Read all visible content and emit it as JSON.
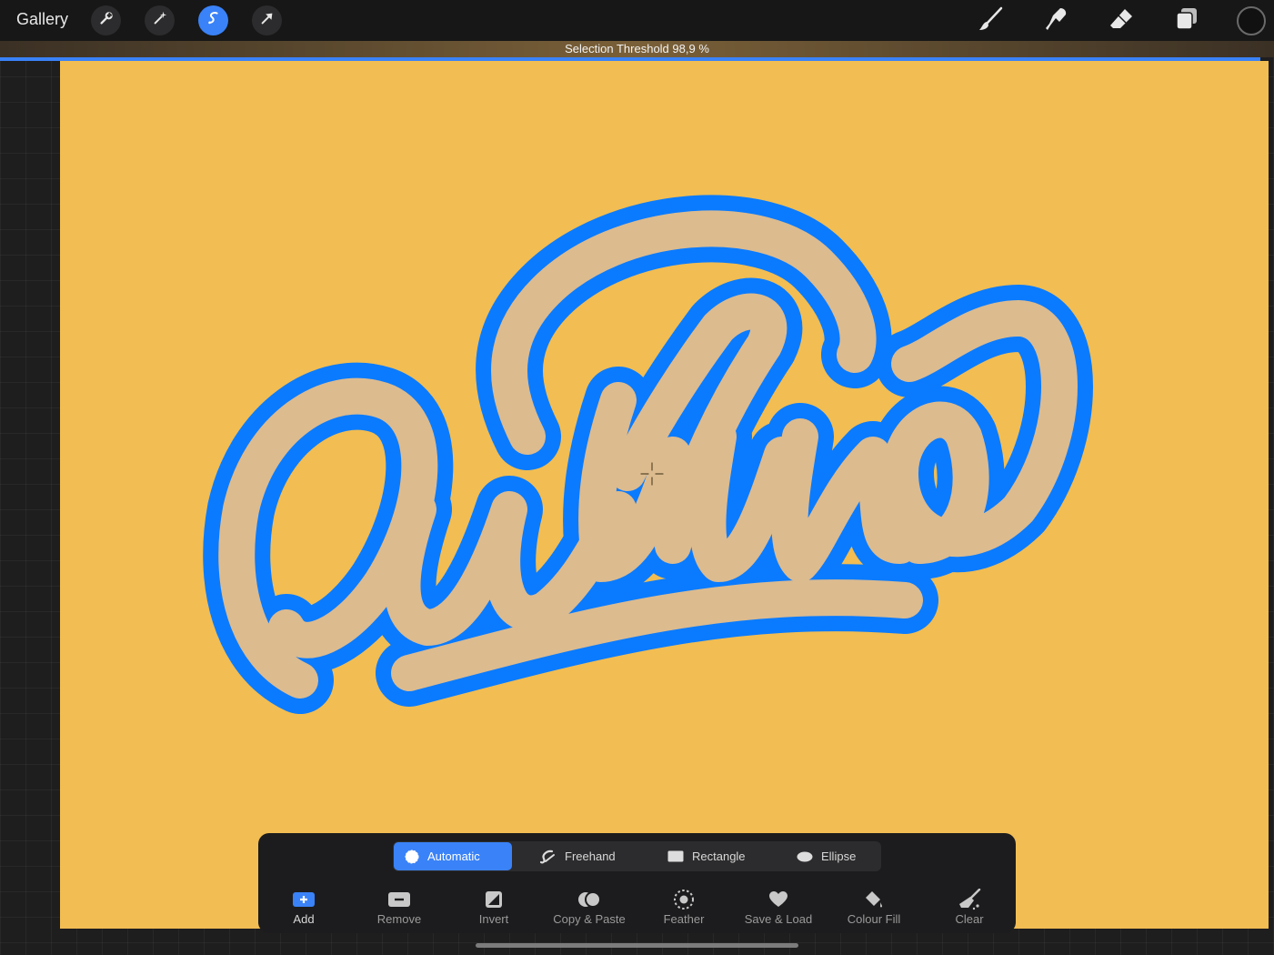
{
  "app": {
    "gallery_label": "Gallery"
  },
  "toolbar": {
    "left_tools": [
      {
        "name": "Actions",
        "icon": "wrench-icon"
      },
      {
        "name": "Adjustments",
        "icon": "magic-wand-icon"
      },
      {
        "name": "Selection",
        "icon": "selection-icon",
        "active": true
      },
      {
        "name": "Transform",
        "icon": "arrow-cursor-icon"
      }
    ],
    "right_tools": [
      {
        "name": "Paint",
        "icon": "brush-icon"
      },
      {
        "name": "Smudge",
        "icon": "smudge-icon"
      },
      {
        "name": "Erase",
        "icon": "eraser-icon"
      },
      {
        "name": "Layers",
        "icon": "layers-icon"
      }
    ],
    "color": "#111111"
  },
  "threshold": {
    "label": "Selection Threshold 98,9 %",
    "value": 0.989
  },
  "selection_panel": {
    "modes": [
      {
        "label": "Automatic",
        "icon": "automatic-icon",
        "active": true
      },
      {
        "label": "Freehand",
        "icon": "freehand-icon"
      },
      {
        "label": "Rectangle",
        "icon": "rectangle-icon"
      },
      {
        "label": "Ellipse",
        "icon": "ellipse-icon"
      }
    ],
    "actions": [
      {
        "label": "Add",
        "icon": "add-icon"
      },
      {
        "label": "Remove",
        "icon": "remove-icon"
      },
      {
        "label": "Invert",
        "icon": "invert-icon"
      },
      {
        "label": "Copy & Paste",
        "icon": "copy-paste-icon"
      },
      {
        "label": "Feather",
        "icon": "feather-icon"
      },
      {
        "label": "Save & Load",
        "icon": "heart-icon"
      },
      {
        "label": "Colour Fill",
        "icon": "colour-fill-icon"
      },
      {
        "label": "Clear",
        "icon": "clear-icon"
      }
    ]
  },
  "colors": {
    "accent": "#3a82f7",
    "canvas": "#f2bd52",
    "selection_outline": "#0a7bff",
    "lettering_fill": "#dcbb8f"
  }
}
